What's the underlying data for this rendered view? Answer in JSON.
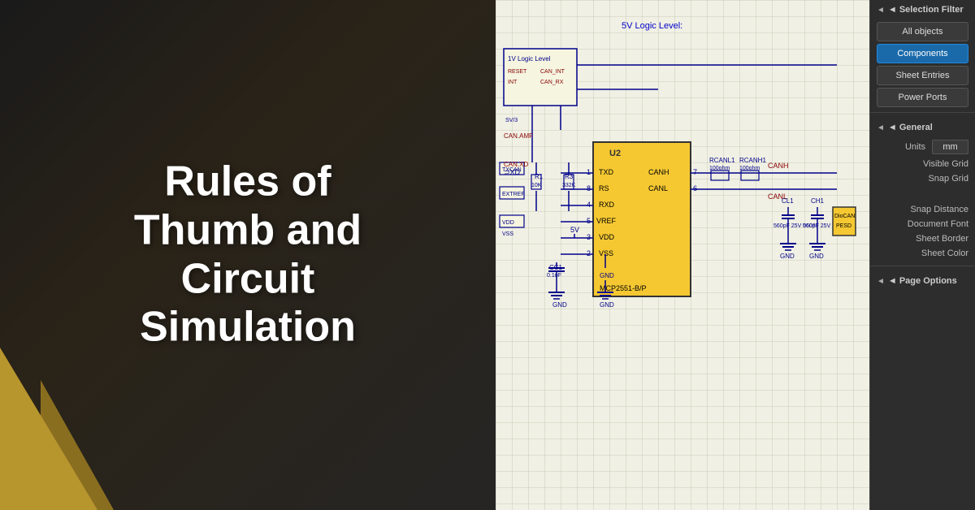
{
  "left_panel": {
    "title_line1": "Rules of",
    "title_line2": "Thumb and",
    "title_line3": "Circuit",
    "title_line4": "Simulation"
  },
  "right_panel": {
    "selection_filter_header": "◄ Selection Filter",
    "buttons": [
      {
        "label": "All objects",
        "active": false
      },
      {
        "label": "Components",
        "active": true
      },
      {
        "label": "Sheet Entries",
        "active": false
      },
      {
        "label": "Power Ports",
        "active": false
      }
    ],
    "general_header": "◄ General",
    "units_label": "Units",
    "units_value": "mm",
    "visible_grid_label": "Visible Grid",
    "snap_grid_label": "Snap Grid",
    "snap_distance_label": "Snap Distance",
    "document_font_label": "Document Font",
    "sheet_border_label": "Sheet Border",
    "sheet_color_label": "Sheet Color",
    "page_options_header": "◄ Page Options"
  },
  "schematic": {
    "label_5v": "5V Logic Level:",
    "ic_name": "MCP2551-B/P",
    "ic_pins": [
      "TXD",
      "RS",
      "RXD",
      "VREF",
      "VDD",
      "VSS",
      "CANH",
      "CANL"
    ],
    "net_canh": "CANH",
    "net_canl": "CANL"
  }
}
